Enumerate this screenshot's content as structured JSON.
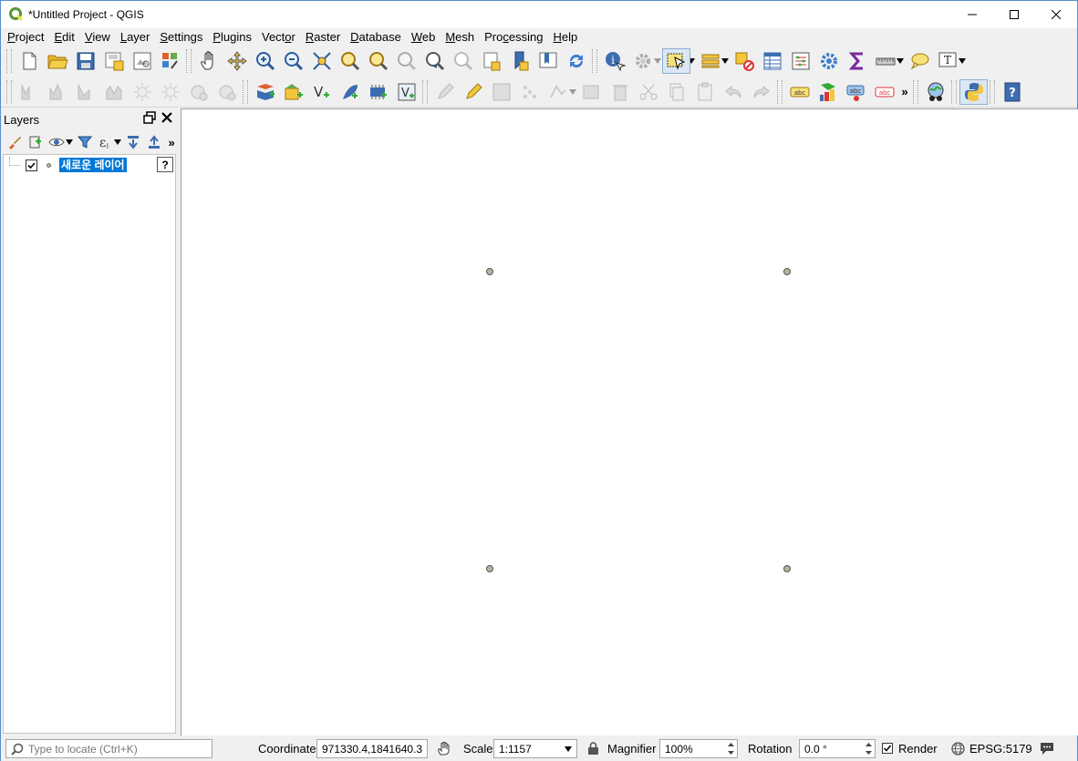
{
  "window": {
    "title": "*Untitled Project - QGIS"
  },
  "menu": [
    {
      "label": "Project",
      "u": "P",
      "rest": "roject"
    },
    {
      "label": "Edit",
      "u": "E",
      "rest": "dit"
    },
    {
      "label": "View",
      "u": "V",
      "rest": "iew"
    },
    {
      "label": "Layer",
      "u": "L",
      "rest": "ayer"
    },
    {
      "label": "Settings",
      "u": "S",
      "rest": "ettings"
    },
    {
      "label": "Plugins",
      "u": "P",
      "rest": "lugins"
    },
    {
      "label": "Vector",
      "pre": "Vect",
      "u": "o",
      "rest": "r"
    },
    {
      "label": "Raster",
      "u": "R",
      "rest": "aster"
    },
    {
      "label": "Database",
      "u": "D",
      "rest": "atabase"
    },
    {
      "label": "Web",
      "u": "W",
      "rest": "eb"
    },
    {
      "label": "Mesh",
      "u": "M",
      "rest": "esh"
    },
    {
      "label": "Processing",
      "pre": "Pro",
      "u": "c",
      "rest": "essing"
    },
    {
      "label": "Help",
      "u": "H",
      "rest": "elp"
    }
  ],
  "layers_panel": {
    "title": "Layers",
    "layers": [
      {
        "name": "새로운 레이어",
        "checked": true,
        "help": "?"
      }
    ]
  },
  "statusbar": {
    "locator_placeholder": "Type to locate (Ctrl+K)",
    "coordinate_label": "Coordinate",
    "coordinate_value": "971330.4,1841640.3",
    "scale_label": "Scale",
    "scale_value": "1:1157",
    "magnifier_label": "Magnifier",
    "magnifier_value": "100%",
    "rotation_label": "Rotation",
    "rotation_value": "0.0 °",
    "render_label": "Render",
    "render_checked": true,
    "crs": "EPSG:5179"
  },
  "colors": {
    "point_fill": "#b9b29c",
    "selection": "#0078d7",
    "qgis_green": "#589632"
  }
}
